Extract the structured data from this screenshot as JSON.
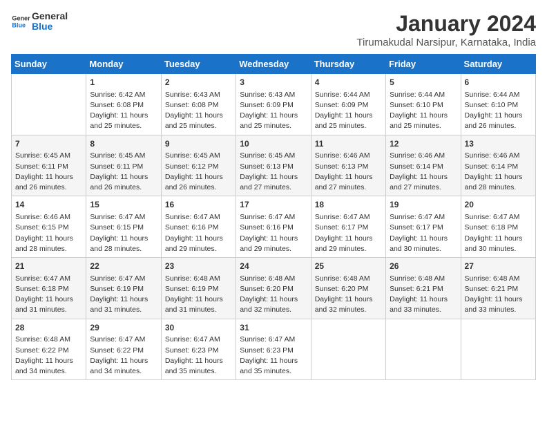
{
  "logo": {
    "text_general": "General",
    "text_blue": "Blue"
  },
  "header": {
    "title": "January 2024",
    "subtitle": "Tirumakudal Narsipur, Karnataka, India"
  },
  "days_of_week": [
    "Sunday",
    "Monday",
    "Tuesday",
    "Wednesday",
    "Thursday",
    "Friday",
    "Saturday"
  ],
  "weeks": [
    [
      {
        "day": "",
        "sunrise": "",
        "sunset": "",
        "daylight": ""
      },
      {
        "day": "1",
        "sunrise": "Sunrise: 6:42 AM",
        "sunset": "Sunset: 6:08 PM",
        "daylight": "Daylight: 11 hours and 25 minutes."
      },
      {
        "day": "2",
        "sunrise": "Sunrise: 6:43 AM",
        "sunset": "Sunset: 6:08 PM",
        "daylight": "Daylight: 11 hours and 25 minutes."
      },
      {
        "day": "3",
        "sunrise": "Sunrise: 6:43 AM",
        "sunset": "Sunset: 6:09 PM",
        "daylight": "Daylight: 11 hours and 25 minutes."
      },
      {
        "day": "4",
        "sunrise": "Sunrise: 6:44 AM",
        "sunset": "Sunset: 6:09 PM",
        "daylight": "Daylight: 11 hours and 25 minutes."
      },
      {
        "day": "5",
        "sunrise": "Sunrise: 6:44 AM",
        "sunset": "Sunset: 6:10 PM",
        "daylight": "Daylight: 11 hours and 25 minutes."
      },
      {
        "day": "6",
        "sunrise": "Sunrise: 6:44 AM",
        "sunset": "Sunset: 6:10 PM",
        "daylight": "Daylight: 11 hours and 26 minutes."
      }
    ],
    [
      {
        "day": "7",
        "sunrise": "Sunrise: 6:45 AM",
        "sunset": "Sunset: 6:11 PM",
        "daylight": "Daylight: 11 hours and 26 minutes."
      },
      {
        "day": "8",
        "sunrise": "Sunrise: 6:45 AM",
        "sunset": "Sunset: 6:11 PM",
        "daylight": "Daylight: 11 hours and 26 minutes."
      },
      {
        "day": "9",
        "sunrise": "Sunrise: 6:45 AM",
        "sunset": "Sunset: 6:12 PM",
        "daylight": "Daylight: 11 hours and 26 minutes."
      },
      {
        "day": "10",
        "sunrise": "Sunrise: 6:45 AM",
        "sunset": "Sunset: 6:13 PM",
        "daylight": "Daylight: 11 hours and 27 minutes."
      },
      {
        "day": "11",
        "sunrise": "Sunrise: 6:46 AM",
        "sunset": "Sunset: 6:13 PM",
        "daylight": "Daylight: 11 hours and 27 minutes."
      },
      {
        "day": "12",
        "sunrise": "Sunrise: 6:46 AM",
        "sunset": "Sunset: 6:14 PM",
        "daylight": "Daylight: 11 hours and 27 minutes."
      },
      {
        "day": "13",
        "sunrise": "Sunrise: 6:46 AM",
        "sunset": "Sunset: 6:14 PM",
        "daylight": "Daylight: 11 hours and 28 minutes."
      }
    ],
    [
      {
        "day": "14",
        "sunrise": "Sunrise: 6:46 AM",
        "sunset": "Sunset: 6:15 PM",
        "daylight": "Daylight: 11 hours and 28 minutes."
      },
      {
        "day": "15",
        "sunrise": "Sunrise: 6:47 AM",
        "sunset": "Sunset: 6:15 PM",
        "daylight": "Daylight: 11 hours and 28 minutes."
      },
      {
        "day": "16",
        "sunrise": "Sunrise: 6:47 AM",
        "sunset": "Sunset: 6:16 PM",
        "daylight": "Daylight: 11 hours and 29 minutes."
      },
      {
        "day": "17",
        "sunrise": "Sunrise: 6:47 AM",
        "sunset": "Sunset: 6:16 PM",
        "daylight": "Daylight: 11 hours and 29 minutes."
      },
      {
        "day": "18",
        "sunrise": "Sunrise: 6:47 AM",
        "sunset": "Sunset: 6:17 PM",
        "daylight": "Daylight: 11 hours and 29 minutes."
      },
      {
        "day": "19",
        "sunrise": "Sunrise: 6:47 AM",
        "sunset": "Sunset: 6:17 PM",
        "daylight": "Daylight: 11 hours and 30 minutes."
      },
      {
        "day": "20",
        "sunrise": "Sunrise: 6:47 AM",
        "sunset": "Sunset: 6:18 PM",
        "daylight": "Daylight: 11 hours and 30 minutes."
      }
    ],
    [
      {
        "day": "21",
        "sunrise": "Sunrise: 6:47 AM",
        "sunset": "Sunset: 6:18 PM",
        "daylight": "Daylight: 11 hours and 31 minutes."
      },
      {
        "day": "22",
        "sunrise": "Sunrise: 6:47 AM",
        "sunset": "Sunset: 6:19 PM",
        "daylight": "Daylight: 11 hours and 31 minutes."
      },
      {
        "day": "23",
        "sunrise": "Sunrise: 6:48 AM",
        "sunset": "Sunset: 6:19 PM",
        "daylight": "Daylight: 11 hours and 31 minutes."
      },
      {
        "day": "24",
        "sunrise": "Sunrise: 6:48 AM",
        "sunset": "Sunset: 6:20 PM",
        "daylight": "Daylight: 11 hours and 32 minutes."
      },
      {
        "day": "25",
        "sunrise": "Sunrise: 6:48 AM",
        "sunset": "Sunset: 6:20 PM",
        "daylight": "Daylight: 11 hours and 32 minutes."
      },
      {
        "day": "26",
        "sunrise": "Sunrise: 6:48 AM",
        "sunset": "Sunset: 6:21 PM",
        "daylight": "Daylight: 11 hours and 33 minutes."
      },
      {
        "day": "27",
        "sunrise": "Sunrise: 6:48 AM",
        "sunset": "Sunset: 6:21 PM",
        "daylight": "Daylight: 11 hours and 33 minutes."
      }
    ],
    [
      {
        "day": "28",
        "sunrise": "Sunrise: 6:48 AM",
        "sunset": "Sunset: 6:22 PM",
        "daylight": "Daylight: 11 hours and 34 minutes."
      },
      {
        "day": "29",
        "sunrise": "Sunrise: 6:47 AM",
        "sunset": "Sunset: 6:22 PM",
        "daylight": "Daylight: 11 hours and 34 minutes."
      },
      {
        "day": "30",
        "sunrise": "Sunrise: 6:47 AM",
        "sunset": "Sunset: 6:23 PM",
        "daylight": "Daylight: 11 hours and 35 minutes."
      },
      {
        "day": "31",
        "sunrise": "Sunrise: 6:47 AM",
        "sunset": "Sunset: 6:23 PM",
        "daylight": "Daylight: 11 hours and 35 minutes."
      },
      {
        "day": "",
        "sunrise": "",
        "sunset": "",
        "daylight": ""
      },
      {
        "day": "",
        "sunrise": "",
        "sunset": "",
        "daylight": ""
      },
      {
        "day": "",
        "sunrise": "",
        "sunset": "",
        "daylight": ""
      }
    ]
  ]
}
